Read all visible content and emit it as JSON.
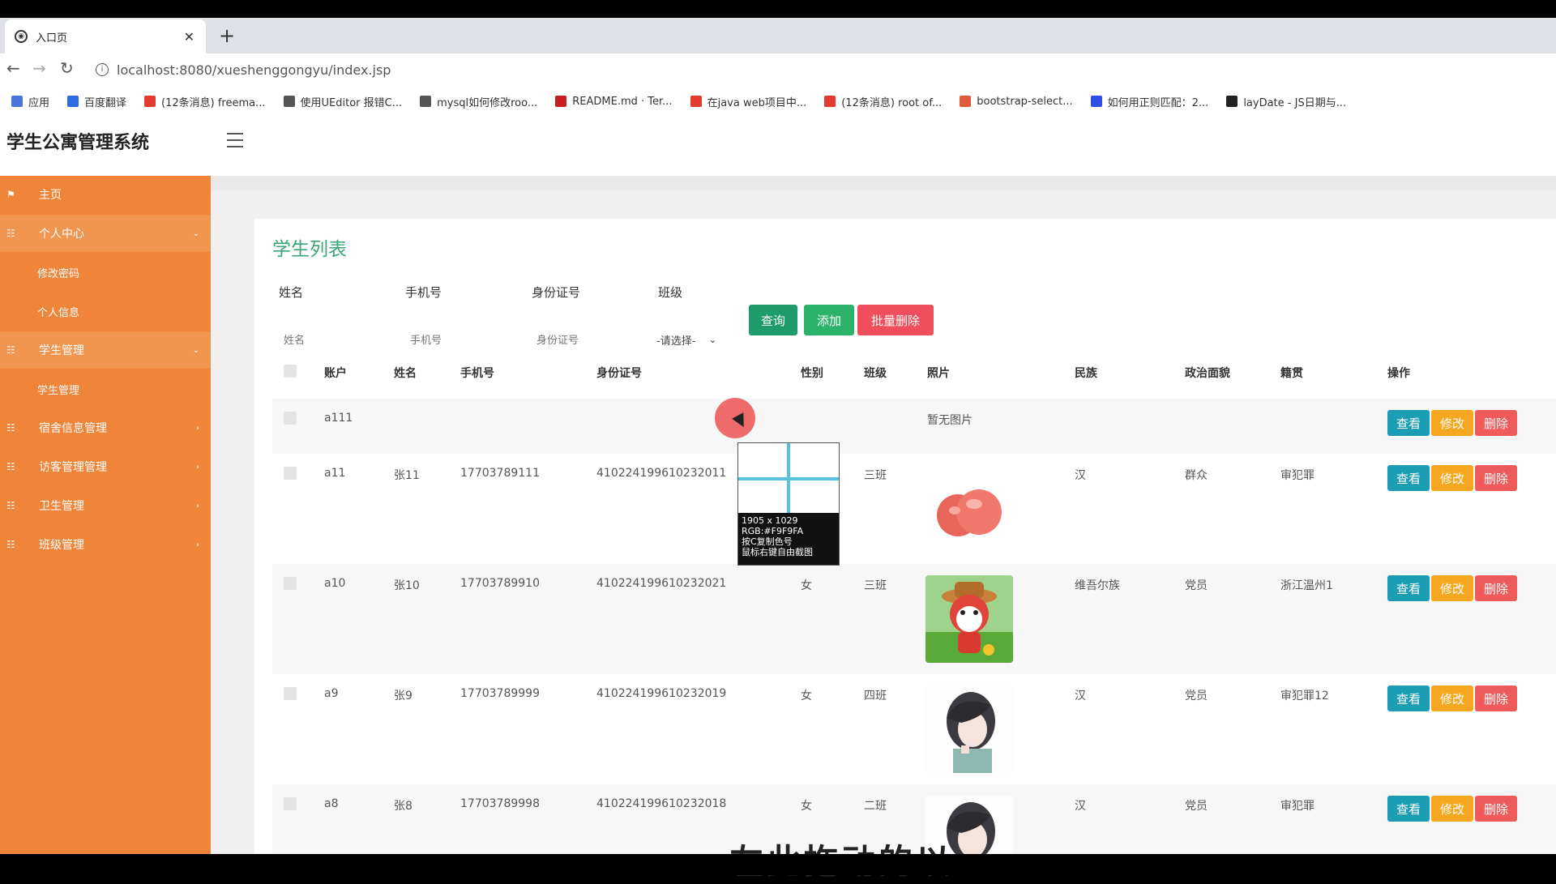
{
  "browser": {
    "tab_title": "入口页",
    "tab_close": "✕",
    "new_tab": "+",
    "url": "localhost:8080/xueshenggongyu/index.jsp",
    "bookmarks": [
      {
        "label": "应用",
        "icon": "apps-grid-icon",
        "color": "#4a74d8"
      },
      {
        "label": "百度翻译",
        "icon": "baidu-translate-icon",
        "color": "#2e6be6"
      },
      {
        "label": "(12条消息) freema...",
        "icon": "csdn-icon",
        "color": "#e33b2f"
      },
      {
        "label": "使用UEditor 报错C...",
        "icon": "ueditor-icon",
        "color": "#555555"
      },
      {
        "label": "mysql如何修改roo...",
        "icon": "mysql-icon",
        "color": "#555555"
      },
      {
        "label": "README.md · Ter...",
        "icon": "gitee-icon",
        "color": "#c71d23"
      },
      {
        "label": "在java web项目中...",
        "icon": "csdn-icon",
        "color": "#e33b2f"
      },
      {
        "label": "(12条消息) root of...",
        "icon": "csdn-icon",
        "color": "#e33b2f"
      },
      {
        "label": "bootstrap-select...",
        "icon": "bootstrap-icon",
        "color": "#e05c3a"
      },
      {
        "label": "如何用正则匹配：2...",
        "icon": "baidu-paw-icon",
        "color": "#2e4ee6"
      },
      {
        "label": "layDate - JS日期与...",
        "icon": "layui-icon",
        "color": "#222222"
      }
    ]
  },
  "app": {
    "title": "学生公寓管理系统",
    "sidebar": {
      "items": [
        {
          "label": "主页",
          "icon": "flag-icon"
        },
        {
          "label": "个人中心",
          "icon": "grid-icon",
          "arrow": "⌄"
        },
        {
          "label": "修改密码",
          "sub": true
        },
        {
          "label": "个人信息",
          "sub": true
        },
        {
          "label": "学生管理",
          "icon": "grid-icon",
          "arrow": "⌄"
        },
        {
          "label": "学生管理",
          "sub": true
        },
        {
          "label": "宿舍信息管理",
          "icon": "grid-icon",
          "arrow": "›"
        },
        {
          "label": "访客管理管理",
          "icon": "grid-icon",
          "arrow": "›"
        },
        {
          "label": "卫生管理",
          "icon": "grid-icon",
          "arrow": "›"
        },
        {
          "label": "班级管理",
          "icon": "grid-icon",
          "arrow": "›"
        }
      ]
    },
    "panel": {
      "title": "学生列表",
      "search": {
        "name_label": "姓名",
        "name_placeholder": "姓名",
        "phone_label": "手机号",
        "phone_placeholder": "手机号",
        "id_label": "身份证号",
        "id_placeholder": "身份证号",
        "class_label": "班级",
        "class_selected": "-请选择-"
      },
      "buttons": {
        "query": "查询",
        "add": "添加",
        "batch_delete": "批量删除"
      },
      "colors": {
        "query": "#1e9b6a",
        "add": "#2bb36a",
        "batch_delete": "#ef4f5c"
      },
      "table": {
        "headers": [
          "账户",
          "姓名",
          "手机号",
          "身份证号",
          "性别",
          "班级",
          "照片",
          "民族",
          "政治面貌",
          "籍贯",
          "操作"
        ],
        "rows": [
          {
            "account": "a111",
            "name": "",
            "phone": "",
            "id_card": "",
            "gender": "",
            "class": "",
            "photo": "暂无图片",
            "photo_type": "none",
            "ethnicity": "",
            "political": "",
            "hometown": ""
          },
          {
            "account": "a11",
            "name": "张11",
            "phone": "17703789111",
            "id_card": "410224199610232011",
            "gender": "",
            "class": "三班",
            "photo": "",
            "photo_type": "apple",
            "ethnicity": "汉",
            "political": "群众",
            "hometown": "审犯罪"
          },
          {
            "account": "a10",
            "name": "张10",
            "phone": "17703789910",
            "id_card": "410224199610232021",
            "gender": "女",
            "class": "三班",
            "photo": "",
            "photo_type": "cartoon",
            "ethnicity": "维吾尔族",
            "political": "党员",
            "hometown": "浙江温州1"
          },
          {
            "account": "a9",
            "name": "张9",
            "phone": "17703789999",
            "id_card": "410224199610232019",
            "gender": "女",
            "class": "四班",
            "photo": "",
            "photo_type": "girl",
            "ethnicity": "汉",
            "political": "党员",
            "hometown": "审犯罪12"
          },
          {
            "account": "a8",
            "name": "张8",
            "phone": "17703789998",
            "id_card": "410224199610232018",
            "gender": "女",
            "class": "二班",
            "photo": "",
            "photo_type": "girl",
            "ethnicity": "汉",
            "political": "党员",
            "hometown": "审犯罪"
          }
        ],
        "actions": {
          "view": "查看",
          "edit": "修改",
          "delete": "删除"
        }
      }
    }
  },
  "color_picker": {
    "line1": "1905 x 1029",
    "line2": "RGB:#F9F9FA",
    "line3": "按C复制色号",
    "line4": "鼠标右键自由截图"
  },
  "overlay_text": "左此拖动的以"
}
